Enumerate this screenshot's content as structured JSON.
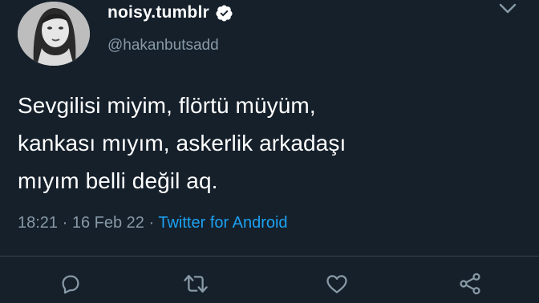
{
  "tweet": {
    "display_name": "noisy.tumblr",
    "verified": true,
    "handle": "@hakanbutsadd",
    "text": "Sevgilisi miyim, flörtü müyüm,\nkankası mıyım, askerlik arkadaşı\nmıyım belli değil aq.",
    "time": "18:21",
    "date": "16 Feb 22",
    "separator": "·",
    "source": "Twitter for Android"
  },
  "icons": {
    "verified": "verified-badge-icon",
    "more": "chevron-down-icon",
    "reply": "reply-icon",
    "retweet": "retweet-icon",
    "like": "heart-icon",
    "share": "share-icon"
  },
  "colors": {
    "background": "#15202b",
    "text": "#ffffff",
    "muted": "#8899a6",
    "link": "#1da1f2",
    "divider": "#38444d"
  }
}
